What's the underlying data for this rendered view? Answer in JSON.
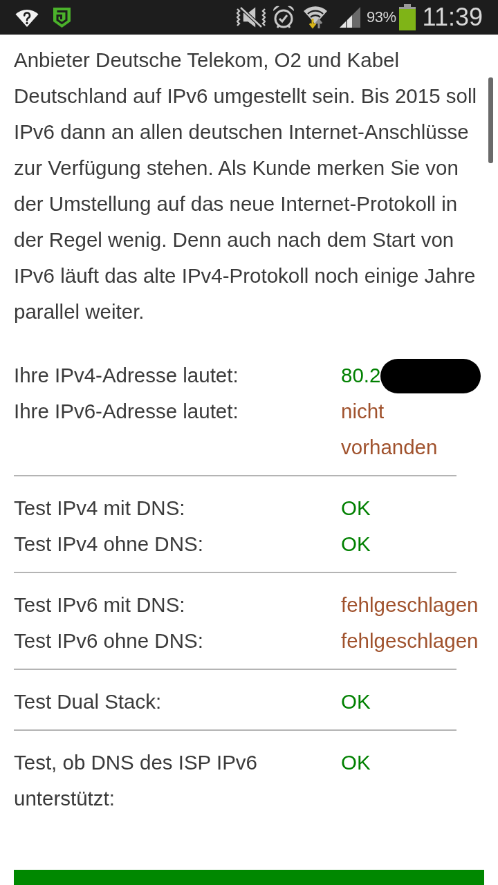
{
  "status_bar": {
    "battery": "93%",
    "time": "11:39"
  },
  "article": {
    "text": "Anbieter Deutsche Telekom, O2 und Kabel\nDeutschland auf IPv6 umgestellt sein. Bis 2015 soll\nIPv6 dann an allen deutschen Internet-Anschlüsse\nzur Verfügung stehen. Als Kunde merken Sie von\nder Umstellung auf das neue Internet-Protokoll in\nder Regel wenig. Denn auch nach dem Start von\nIPv6 läuft das alte IPv4-Protokoll noch einige Jahre\nparallel weiter."
  },
  "results": [
    {
      "rows": [
        {
          "label": "Ihre IPv4-Adresse lautet:",
          "value": "80.2",
          "color": "#008000",
          "redacted": true
        },
        {
          "label": "Ihre IPv6-Adresse lautet:",
          "value": "nicht vorhanden",
          "color": "#a0522d"
        }
      ]
    },
    {
      "rows": [
        {
          "label": "Test IPv4 mit DNS:",
          "value": "OK",
          "color": "#008000"
        },
        {
          "label": "Test IPv4 ohne DNS:",
          "value": "OK",
          "color": "#008000"
        }
      ]
    },
    {
      "rows": [
        {
          "label": "Test IPv6 mit DNS:",
          "value": "fehlgeschlagen",
          "color": "#a0522d"
        },
        {
          "label": "Test IPv6 ohne DNS:",
          "value": "fehlgeschlagen",
          "color": "#a0522d"
        }
      ]
    },
    {
      "rows": [
        {
          "label": "Test Dual Stack:",
          "value": "OK",
          "color": "#008000"
        }
      ]
    },
    {
      "rows": [
        {
          "label": "Test, ob DNS des ISP IPv6 unterstützt:",
          "value": "OK",
          "color": "#008000"
        }
      ]
    }
  ]
}
